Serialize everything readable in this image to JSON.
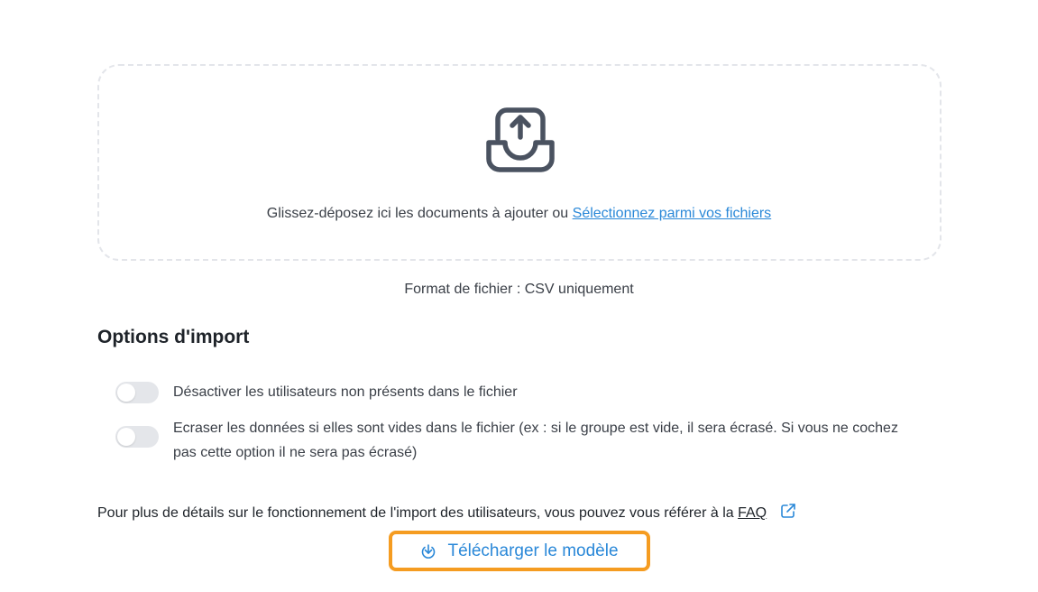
{
  "dropzone": {
    "icon": "upload-tray-icon",
    "text": "Glissez-déposez ici les documents à ajouter ou",
    "link_label": "Sélectionnez parmi vos fichiers"
  },
  "format_text": "Format de fichier : CSV uniquement",
  "import_options": {
    "title": "Options d'import",
    "options": [
      {
        "label": "Désactiver les utilisateurs non présents dans le fichier",
        "enabled": false
      },
      {
        "label": "Ecraser les données si elles sont vides dans le fichier (ex : si le groupe est vide, il sera écrasé. Si vous ne cochez pas cette option il ne sera pas écrasé)",
        "enabled": false
      }
    ]
  },
  "faq": {
    "text": "Pour plus de détails sur le fonctionnement de l'import des utilisateurs, vous pouvez vous référer à la",
    "link_label": "FAQ",
    "icon": "external-link-icon"
  },
  "download": {
    "label": "Télécharger le modèle",
    "icon": "download-icon"
  },
  "colors": {
    "accent": "#2a88d8",
    "highlight": "#f59c21",
    "toggle_off": "#e4e6ea",
    "text": "#3a3f47"
  }
}
